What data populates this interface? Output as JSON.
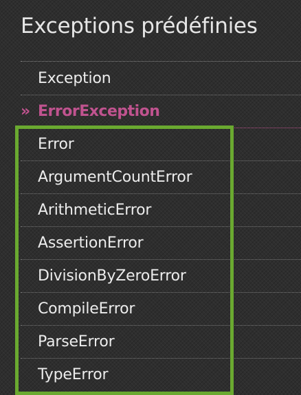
{
  "panel": {
    "title": "Exceptions prédéfinies"
  },
  "nav": {
    "items": [
      {
        "label": "Exception",
        "current": false
      },
      {
        "label": "ErrorException",
        "current": true,
        "marker": "»"
      }
    ],
    "sub_items": [
      {
        "label": "Error"
      },
      {
        "label": "ArgumentCountError"
      },
      {
        "label": "ArithmeticError"
      },
      {
        "label": "AssertionError"
      },
      {
        "label": "DivisionByZeroError"
      },
      {
        "label": "CompileError"
      },
      {
        "label": "ParseError"
      },
      {
        "label": "TypeError"
      }
    ]
  },
  "colors": {
    "background": "#2e2e2e",
    "text": "#ececec",
    "current_accent": "#c0538f",
    "highlight_border": "#6aa930"
  }
}
